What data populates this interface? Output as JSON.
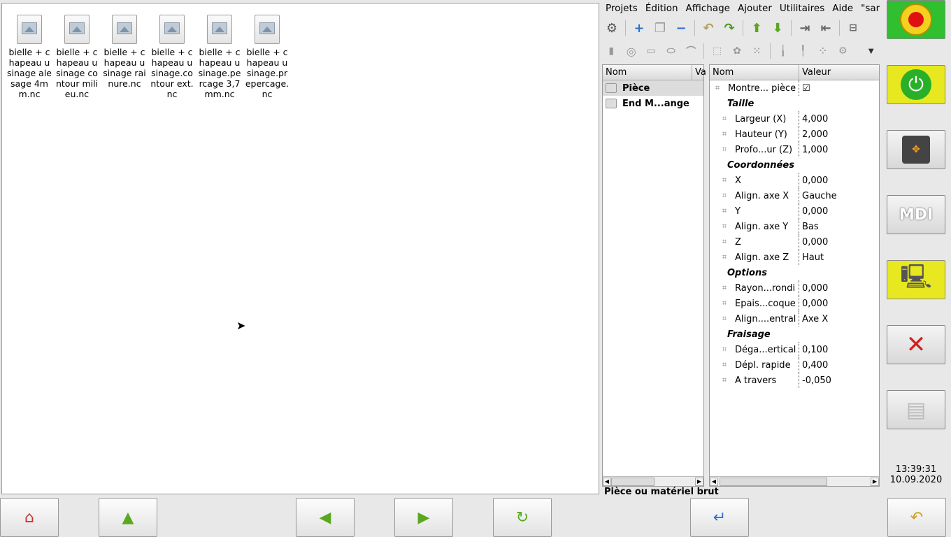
{
  "files": [
    {
      "name": "bielle + chapeau usinage alesage 4mm.nc"
    },
    {
      "name": "bielle + chapeau usinage contour milieu.nc"
    },
    {
      "name": "bielle + chapeau usinage rainure.nc"
    },
    {
      "name": "bielle + chapeau usinage.contour ext.nc"
    },
    {
      "name": "bielle + chapeau usinage.percage 3,7mm.nc"
    },
    {
      "name": "bielle + chapeau usinage.prepercage.nc"
    }
  ],
  "menu": [
    "Projets",
    "Édition",
    "Affichage",
    "Ajouter",
    "Utilitaires",
    "Aide",
    "\"sar"
  ],
  "tree": {
    "col_nom": "Nom",
    "col_va": "Va",
    "items": [
      "Pièce",
      "End M...ange"
    ]
  },
  "props": {
    "col_nom": "Nom",
    "col_valeur": "Valeur",
    "rows": [
      {
        "type": "item",
        "name": "Montre... pièce",
        "value": "☑"
      },
      {
        "type": "group",
        "name": "Taille"
      },
      {
        "type": "item",
        "name": "Largeur (X)",
        "value": "4,000"
      },
      {
        "type": "item",
        "name": "Hauteur (Y)",
        "value": "2,000"
      },
      {
        "type": "item",
        "name": "Profo...ur (Z)",
        "value": "1,000"
      },
      {
        "type": "group",
        "name": "Coordonnées"
      },
      {
        "type": "item",
        "name": "X",
        "value": "0,000"
      },
      {
        "type": "item",
        "name": "Align. axe X",
        "value": "Gauche"
      },
      {
        "type": "item",
        "name": "Y",
        "value": "0,000"
      },
      {
        "type": "item",
        "name": "Align. axe Y",
        "value": "Bas"
      },
      {
        "type": "item",
        "name": "Z",
        "value": "0,000"
      },
      {
        "type": "item",
        "name": "Align. axe Z",
        "value": "Haut"
      },
      {
        "type": "group",
        "name": "Options"
      },
      {
        "type": "item",
        "name": "Rayon...rondi",
        "value": "0,000"
      },
      {
        "type": "item",
        "name": "Épais...coque",
        "value": "0,000"
      },
      {
        "type": "item",
        "name": "Align....entral",
        "value": "Axe X"
      },
      {
        "type": "group",
        "name": "Fraisage"
      },
      {
        "type": "item",
        "name": "Déga...ertical",
        "value": "0,100"
      },
      {
        "type": "item",
        "name": "Dépl. rapide",
        "value": "0,400"
      },
      {
        "type": "item",
        "name": "À travers",
        "value": "-0,050"
      }
    ]
  },
  "status": "Pièce ou matériel brut",
  "mdi_label": "MDI",
  "clock": {
    "time": "13:39:31",
    "date": "10.09.2020"
  }
}
